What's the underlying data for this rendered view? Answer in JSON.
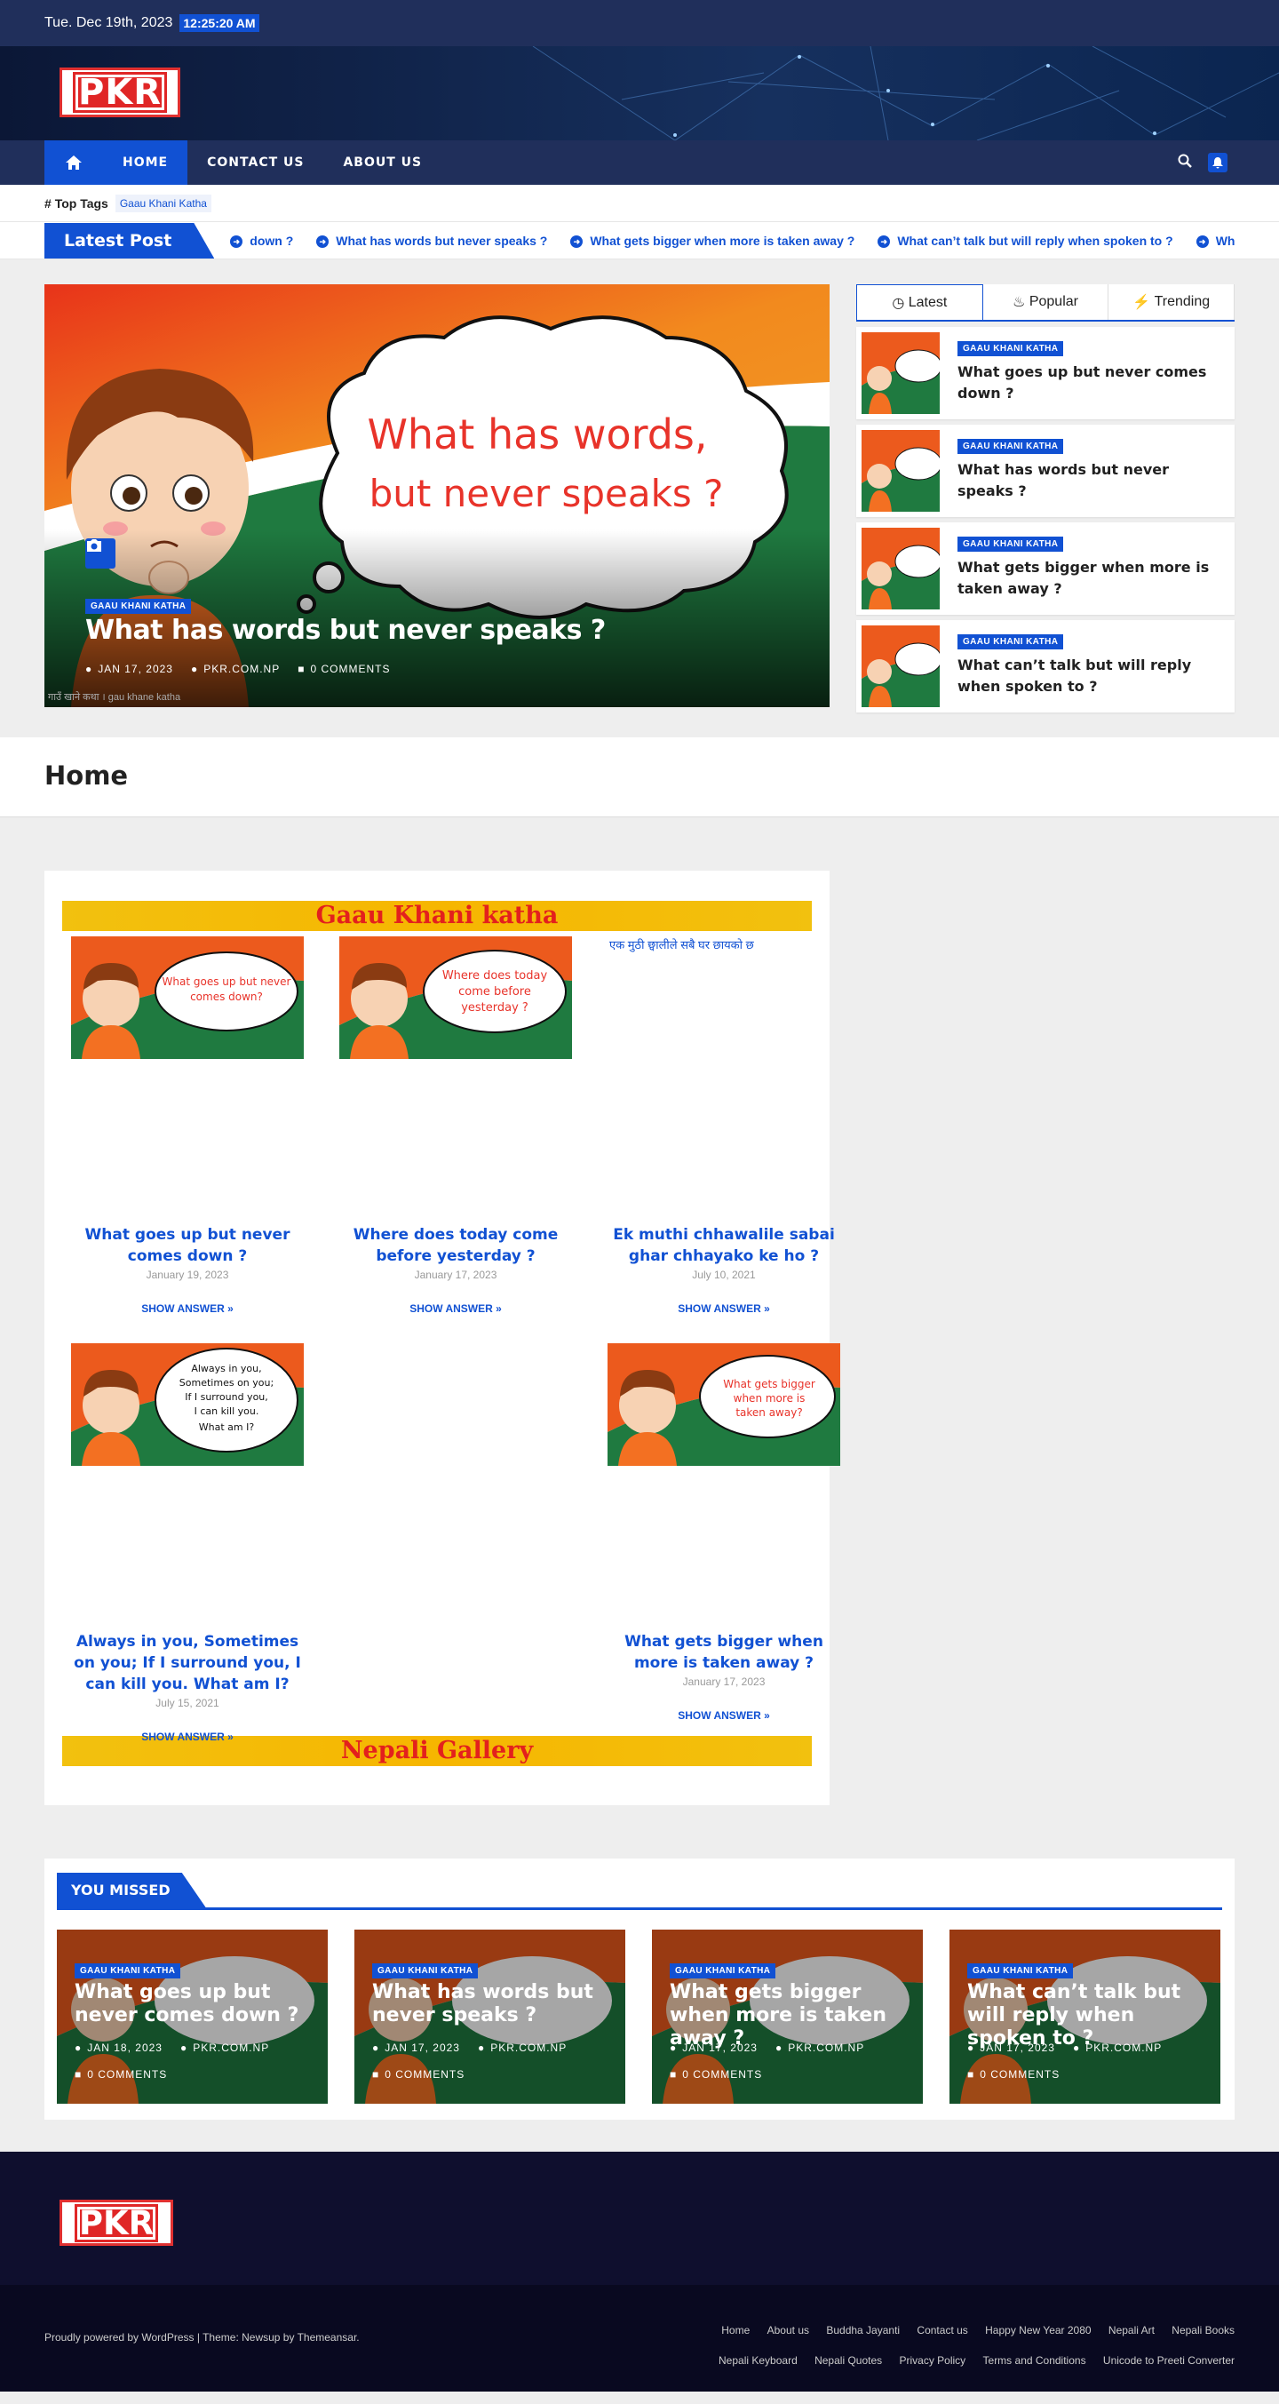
{
  "topbar": {
    "date": "Tue. Dec 19th, 2023",
    "time": "12:25:20 AM"
  },
  "site": {
    "logo_text": "PKR"
  },
  "nav": {
    "items": [
      "HOME",
      "CONTACT US",
      "ABOUT US"
    ]
  },
  "toptags": {
    "label": "Top Tags",
    "tags": [
      "Gaau Khani Katha"
    ]
  },
  "latest": {
    "label": "Latest Post",
    "items": [
      "down ?",
      "What has words but never speaks ?",
      "What gets bigger when more is taken away ?",
      "What can’t talk but will reply when spoken to ?",
      "What has"
    ]
  },
  "hero": {
    "bubble_line1": "What has words,",
    "bubble_line2": "but never speaks ?",
    "category": "GAAU KHANI KATHA",
    "title": "What has words but never speaks ?",
    "date": "JAN 17, 2023",
    "author": "PKR.COM.NP",
    "comments": "0 COMMENTS",
    "credit": "गाउँ खाने कथा  ।  gau khane katha"
  },
  "sidebar": {
    "tabs": [
      "Latest",
      "Popular",
      "Trending"
    ],
    "items": [
      {
        "category": "GAAU KHANI KATHA",
        "title": "What goes up but never comes down ?"
      },
      {
        "category": "GAAU KHANI KATHA",
        "title": "What has words but never speaks ?"
      },
      {
        "category": "GAAU KHANI KATHA",
        "title": "What gets bigger when more is taken away ?"
      },
      {
        "category": "GAAU KHANI KATHA",
        "title": "What can’t talk but will reply when spoken to ?"
      }
    ]
  },
  "page": {
    "title": "Home"
  },
  "gallery": {
    "banner1": "Gaau Khani katha",
    "banner2": "Nepali Gallery",
    "show_answer": "SHOW ANSWER »",
    "broken_alt": "एक मुठी छ्वालीले सबै घर छायको छ",
    "cards": [
      {
        "title": "What goes up but never comes down ?",
        "date": "January 19, 2023",
        "bubble": "What goes up but never comes down?"
      },
      {
        "title": "Where does today come before yesterday ?",
        "date": "January 17, 2023",
        "bubble": "Where does today come before yesterday ?"
      },
      {
        "title": "Ek muthi chhawalile sabai ghar chhayako ke ho ?",
        "date": "July 10, 2021",
        "bubble": ""
      },
      {
        "title": "Always in you, Sometimes on you; If I surround you, I can kill you. What am I?",
        "date": "July 15, 2021",
        "bubble": "Always in you, Sometimes on you; If I surround you, I can kill you. What am I?"
      },
      {
        "title": "",
        "date": "",
        "bubble": ""
      },
      {
        "title": "What gets bigger when more is taken away ?",
        "date": "January 17, 2023",
        "bubble": "What gets bigger when more is taken away?"
      }
    ]
  },
  "missed": {
    "heading": "YOU MISSED",
    "cards": [
      {
        "category": "GAAU KHANI KATHA",
        "title": "What goes up but never comes down ?",
        "date": "JAN 18, 2023",
        "author": "PKR.COM.NP",
        "comments": "0 COMMENTS"
      },
      {
        "category": "GAAU KHANI KATHA",
        "title": "What has words but never speaks ?",
        "date": "JAN 17, 2023",
        "author": "PKR.COM.NP",
        "comments": "0 COMMENTS"
      },
      {
        "category": "GAAU KHANI KATHA",
        "title": "What gets bigger when more is taken away ?",
        "date": "JAN 17, 2023",
        "author": "PKR.COM.NP",
        "comments": "0 COMMENTS"
      },
      {
        "category": "GAAU KHANI KATHA",
        "title": "What can’t talk but will reply when spoken to ?",
        "date": "JAN 17, 2023",
        "author": "PKR.COM.NP",
        "comments": "0 COMMENTS"
      }
    ]
  },
  "footer": {
    "powered": "Proudly powered by WordPress | Theme: Newsup by Themeansar.",
    "links": [
      "Home",
      "About us",
      "Buddha Jayanti",
      "Contact us",
      "Happy New Year 2080",
      "Nepali Art",
      "Nepali Books",
      "Nepali Keyboard",
      "Nepali Quotes",
      "Privacy Policy",
      "Terms and Conditions",
      "Unicode to Preeti Converter"
    ]
  },
  "colors": {
    "accent": "#1151d3",
    "navy": "#202f5b",
    "banner_yellow": "#f2c10f",
    "banner_red": "#e3201d"
  }
}
